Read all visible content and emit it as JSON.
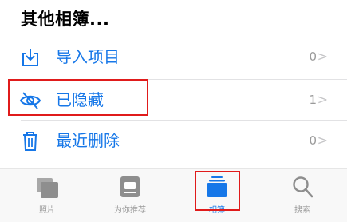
{
  "section": {
    "title": "其他相簿..."
  },
  "rows": [
    {
      "label": "导入项目",
      "count": "0",
      "chevron": ">",
      "icon": "import-icon"
    },
    {
      "label": "已隐藏",
      "count": "1",
      "chevron": ">",
      "icon": "eye-slash-icon"
    },
    {
      "label": "最近删除",
      "count": "0",
      "chevron": ">",
      "icon": "trash-icon"
    }
  ],
  "tabbar": {
    "tabs": [
      {
        "label": "照片",
        "icon": "photos-icon",
        "active": false
      },
      {
        "label": "为你推荐",
        "icon": "for-you-icon",
        "active": false
      },
      {
        "label": "相簿",
        "icon": "albums-icon",
        "active": true
      },
      {
        "label": "搜索",
        "icon": "search-icon",
        "active": false
      }
    ]
  },
  "colors": {
    "accent": "#1677e8",
    "highlight": "#e01b1b",
    "muted": "#9a9a9a"
  }
}
